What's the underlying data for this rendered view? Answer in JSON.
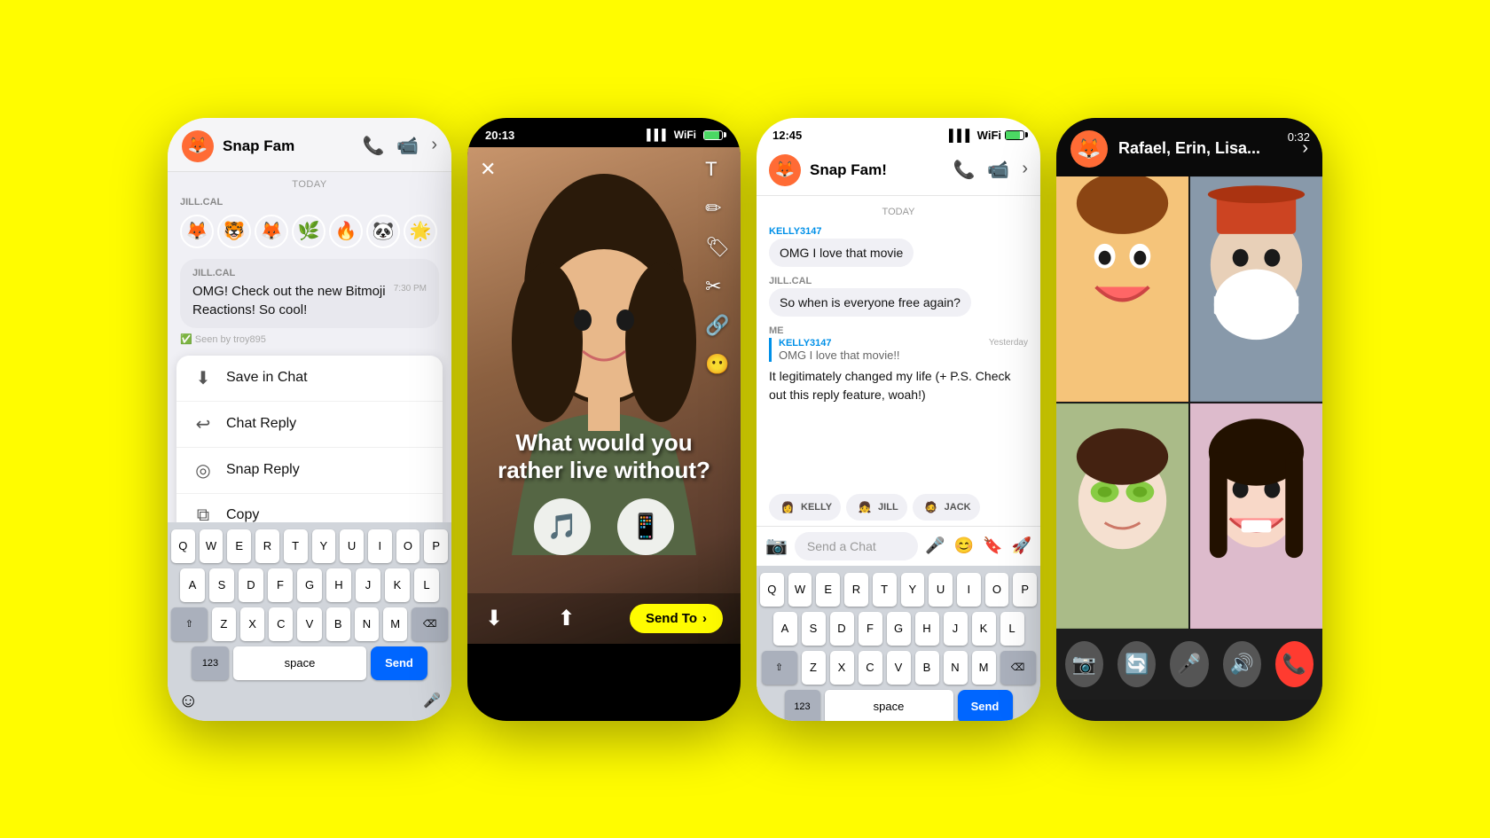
{
  "background_color": "#FFFC00",
  "phone1": {
    "header": {
      "title": "Snap Fam",
      "call_icon": "📞",
      "video_icon": "📹",
      "arrow_icon": "›"
    },
    "date_label": "TODAY",
    "sender": "JILL.CAL",
    "message": {
      "sender_name": "JILL.CAL",
      "time": "7:30 PM",
      "text": "OMG! Check out the new Bitmoji Reactions! So cool!",
      "seen": "Seen by troy895"
    },
    "context_menu": {
      "items": [
        {
          "icon": "💾",
          "label": "Save in Chat"
        },
        {
          "icon": "💬",
          "label": "Chat Reply"
        },
        {
          "icon": "📷",
          "label": "Snap Reply"
        },
        {
          "icon": "📋",
          "label": "Copy"
        }
      ]
    },
    "keyboard": {
      "rows": [
        [
          "Q",
          "W",
          "E",
          "R",
          "T",
          "Y",
          "U",
          "I",
          "O",
          "P"
        ],
        [
          "A",
          "S",
          "D",
          "F",
          "G",
          "H",
          "J",
          "K",
          "L"
        ],
        [
          "Z",
          "X",
          "C",
          "V",
          "B",
          "N",
          "M"
        ]
      ],
      "num_label": "123",
      "space_label": "space",
      "send_label": "Send"
    }
  },
  "phone2": {
    "status": {
      "time": "20:13",
      "signal": "▌▌▌",
      "wifi": "WiFi",
      "battery_pct": 85
    },
    "snap_text": "What would you rather live without?",
    "options": [
      "🎵",
      "📱"
    ],
    "send_to_label": "Send To",
    "toolbar_icons": [
      "T",
      "✏️",
      "🏷️",
      "✂️",
      "📎",
      "😶"
    ]
  },
  "phone3": {
    "status": {
      "time": "12:45",
      "signal": "▌▌▌",
      "wifi": "WiFi"
    },
    "header": {
      "title": "Snap Fam!",
      "call_icon": "📞",
      "video_icon": "📹",
      "arrow_icon": "›"
    },
    "date_label": "TODAY",
    "messages": [
      {
        "sender": "KELLY3147",
        "sender_color": "kelly",
        "text": "OMG I love that movie"
      },
      {
        "sender": "JILL.CAL",
        "sender_color": "jill",
        "text": "So when is everyone free again?"
      },
      {
        "sender": "ME",
        "reply_to": {
          "name": "KELLY3147",
          "date": "Yesterday",
          "text": "OMG I love that movie!!"
        },
        "text": "It legitimately changed my life (+ P.S. Check out this reply feature, woah!)"
      }
    ],
    "reactors": [
      {
        "name": "KELLY",
        "emoji": "👩"
      },
      {
        "name": "JILL",
        "emoji": "👧"
      },
      {
        "name": "JACK",
        "emoji": "🧔"
      }
    ],
    "input_placeholder": "Send a Chat",
    "keyboard": {
      "rows": [
        [
          "Q",
          "W",
          "E",
          "R",
          "T",
          "Y",
          "U",
          "I",
          "O",
          "P"
        ],
        [
          "A",
          "S",
          "D",
          "F",
          "G",
          "H",
          "J",
          "K",
          "L"
        ],
        [
          "Z",
          "X",
          "C",
          "V",
          "B",
          "N",
          "M"
        ]
      ],
      "num_label": "123",
      "space_label": "space",
      "send_label": "Send"
    }
  },
  "phone4": {
    "timer": "0:32",
    "call_name": "Rafael, Erin, Lisa...",
    "chevron": "›",
    "controls": [
      {
        "icon": "📷",
        "type": "gray",
        "label": "camera"
      },
      {
        "icon": "🔄",
        "type": "gray",
        "label": "flip"
      },
      {
        "icon": "🎤",
        "type": "gray",
        "label": "mute"
      },
      {
        "icon": "🔊",
        "type": "gray",
        "label": "speaker"
      },
      {
        "icon": "📞",
        "type": "red",
        "label": "end-call"
      }
    ]
  }
}
